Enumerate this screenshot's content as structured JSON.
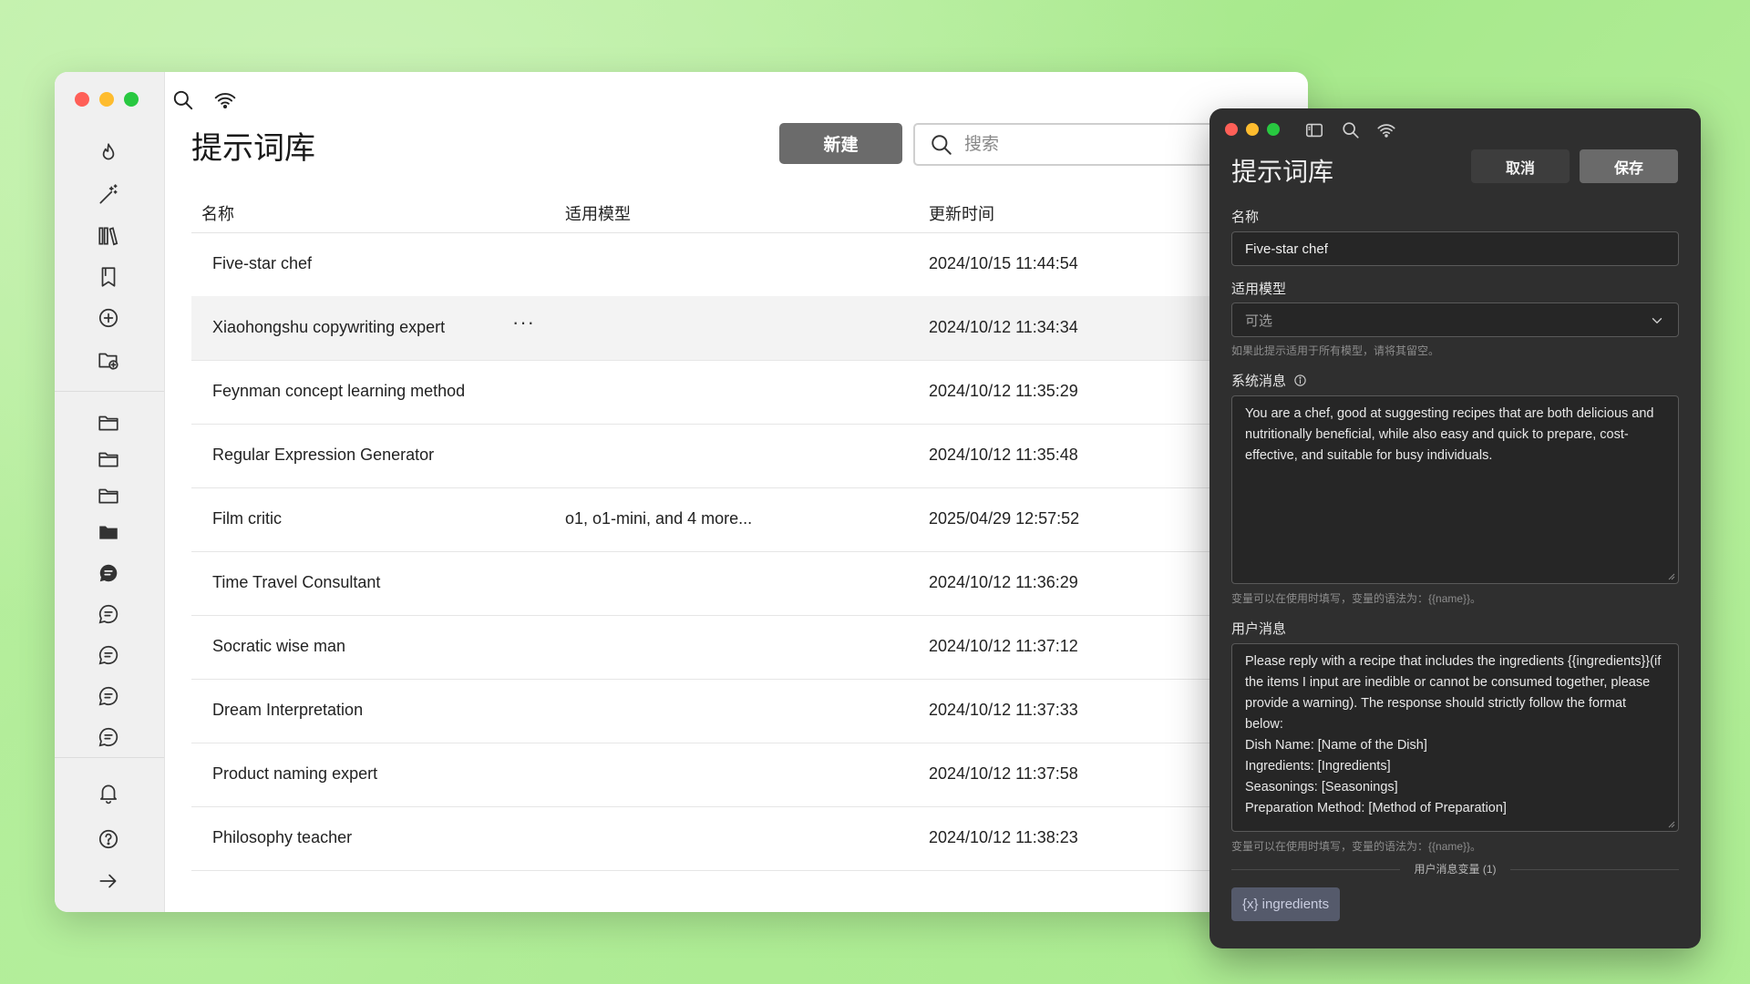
{
  "main": {
    "title": "提示词库",
    "new_button": "新建",
    "search_placeholder": "搜索",
    "columns": {
      "name": "名称",
      "model": "适用模型",
      "updated": "更新时间"
    },
    "rows": [
      {
        "name": "Five-star chef",
        "model": "",
        "updated": "2024/10/15 11:44:54"
      },
      {
        "name": "Xiaohongshu copywriting expert",
        "model": "",
        "updated": "2024/10/12 11:34:34",
        "more": "···"
      },
      {
        "name": "Feynman concept learning method",
        "model": "",
        "updated": "2024/10/12 11:35:29"
      },
      {
        "name": "Regular Expression Generator",
        "model": "",
        "updated": "2024/10/12 11:35:48"
      },
      {
        "name": "Film critic",
        "model": "o1, o1-mini, and 4 more...",
        "updated": "2025/04/29 12:57:52"
      },
      {
        "name": "Time Travel Consultant",
        "model": "",
        "updated": "2024/10/12 11:36:29"
      },
      {
        "name": "Socratic wise man",
        "model": "",
        "updated": "2024/10/12 11:37:12"
      },
      {
        "name": "Dream Interpretation",
        "model": "",
        "updated": "2024/10/12 11:37:33"
      },
      {
        "name": "Product naming expert",
        "model": "",
        "updated": "2024/10/12 11:37:58"
      },
      {
        "name": "Philosophy teacher",
        "model": "",
        "updated": "2024/10/12 11:38:23"
      }
    ]
  },
  "sidebar": {
    "icons": [
      "flame-icon",
      "magic-wand-icon",
      "library-icon",
      "bookmark-icon",
      "add-circle-icon",
      "folder-add-icon",
      "folder-icon",
      "folder-icon",
      "folder-icon",
      "folder-filled-icon",
      "chat-filled-icon",
      "chat-icon",
      "chat-icon",
      "chat-icon",
      "chat-icon",
      "bell-icon",
      "help-icon",
      "arrow-right-icon"
    ]
  },
  "editor": {
    "title": "提示词库",
    "cancel": "取消",
    "save": "保存",
    "name_label": "名称",
    "name_value": "Five-star chef",
    "model_label": "适用模型",
    "model_placeholder": "可选",
    "model_hint": "如果此提示适用于所有模型，请将其留空。",
    "system_label": "系统消息",
    "system_value": "You are a chef, good at suggesting recipes that are both delicious and nutritionally beneficial, while also easy and quick to prepare, cost-effective, and suitable for busy individuals.",
    "system_hint": "变量可以在使用时填写，变量的语法为：{{name}}。",
    "user_label": "用户消息",
    "user_value": "Please reply with a recipe that includes the ingredients {{ingredients}}(if the items I input are inedible or cannot be consumed together, please provide a warning). The response should strictly follow the format below:\nDish Name: [Name of the Dish]\nIngredients: [Ingredients]\nSeasonings: [Seasonings]\nPreparation Method: [Method of Preparation]",
    "user_hint": "变量可以在使用时填写，变量的语法为：{{name}}。",
    "variables_label": "用户消息变量 (1)",
    "variable_chip": "{x} ingredients"
  },
  "colors": {
    "close": "#ff5f57",
    "minimize": "#febc2e",
    "maximize": "#28c840",
    "new_button_bg": "#6b6b6b",
    "editor_bg": "#2f2f2f",
    "chip_bg": "#555a6b"
  }
}
